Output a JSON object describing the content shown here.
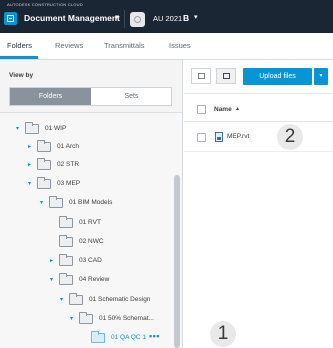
{
  "header": {
    "brand": "AUTODESK CONSTRUCTION CLOUD",
    "app_title": "Document Management",
    "app_caret": "▾",
    "project_name": "AU 2021",
    "project_badge": "B",
    "project_caret": "▾"
  },
  "tabs": [
    {
      "label": "Folders",
      "active": true
    },
    {
      "label": "Reviews"
    },
    {
      "label": "Transmittals"
    },
    {
      "label": "Issues"
    }
  ],
  "left_panel": {
    "view_by_label": "View by",
    "toggle": {
      "folders": "Folders",
      "sets": "Sets"
    },
    "tree": [
      {
        "label": "01 WIP",
        "twisty": "▾"
      },
      {
        "label": "01 Arch",
        "twisty": "▸"
      },
      {
        "label": "02 STR",
        "twisty": "▸"
      },
      {
        "label": "03 MEP",
        "twisty": "▾"
      },
      {
        "label": "01 BIM Models",
        "twisty": "▾"
      },
      {
        "label": "01 RVT",
        "twisty": ""
      },
      {
        "label": "02 NWC",
        "twisty": ""
      },
      {
        "label": "03 CAD",
        "twisty": "▸"
      },
      {
        "label": "04 Review",
        "twisty": "▾"
      },
      {
        "label": "01 Schematic Design",
        "twisty": "▾"
      },
      {
        "label": "01 50% Schemat...",
        "twisty": "▾"
      },
      {
        "label": "01 QA QC 1",
        "twisty": "",
        "selected": true,
        "more": "•••"
      }
    ]
  },
  "right_panel": {
    "upload_label": "Upload files",
    "upload_caret": "▾",
    "col_name": "Name",
    "sort_indicator": "▲",
    "files": [
      {
        "name": "MEP.rvt"
      }
    ]
  },
  "markers": {
    "one": "1",
    "two": "2"
  },
  "colors": {
    "accent": "#0696d7",
    "header_bg": "#1b2634"
  }
}
